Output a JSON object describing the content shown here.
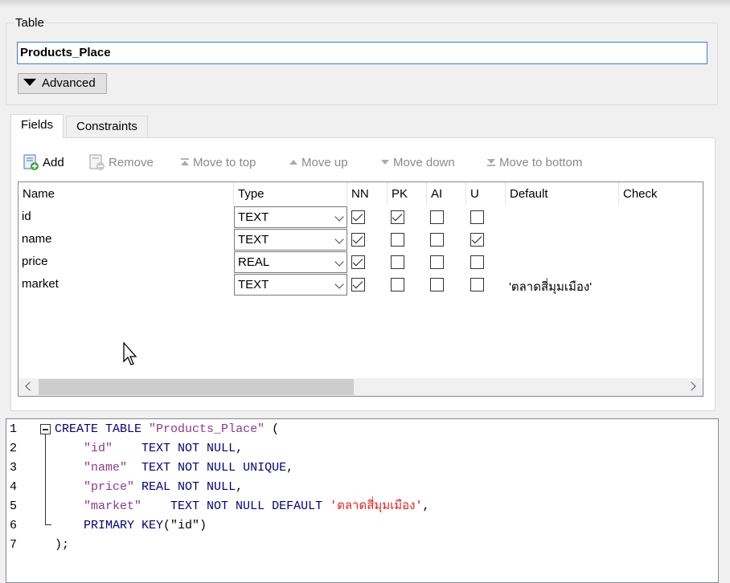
{
  "table_group": {
    "title": "Table",
    "name_value": "Products_Place",
    "advanced_label": "Advanced"
  },
  "tabs": [
    {
      "label": "Fields",
      "active": true
    },
    {
      "label": "Constraints",
      "active": false
    }
  ],
  "toolbar": {
    "add": "Add",
    "remove": "Remove",
    "move_top": "Move to top",
    "move_up": "Move up",
    "move_down": "Move down",
    "move_bottom": "Move to bottom"
  },
  "columns": {
    "name": "Name",
    "type": "Type",
    "nn": "NN",
    "pk": "PK",
    "ai": "AI",
    "u": "U",
    "default": "Default",
    "check": "Check"
  },
  "fields": [
    {
      "name": "id",
      "type": "TEXT",
      "nn": true,
      "pk": true,
      "ai": false,
      "u": false,
      "default": ""
    },
    {
      "name": "name",
      "type": "TEXT",
      "nn": true,
      "pk": false,
      "ai": false,
      "u": true,
      "default": ""
    },
    {
      "name": "price",
      "type": "REAL",
      "nn": true,
      "pk": false,
      "ai": false,
      "u": false,
      "default": ""
    },
    {
      "name": "market",
      "type": "TEXT",
      "nn": true,
      "pk": false,
      "ai": false,
      "u": false,
      "default": "'ตลาดสี่มุมเมือง'"
    }
  ],
  "sql": {
    "line_numbers": [
      "1",
      "2",
      "3",
      "4",
      "5",
      "6",
      "7"
    ],
    "l1_kw": "CREATE TABLE",
    "l1_str": "\"Products_Place\"",
    "l1_tail": " (",
    "l2_str": "\"id\"",
    "l2_kw": "TEXT NOT NULL",
    "l2_tail": ",",
    "l3_str": "\"name\"",
    "l3_kw": "TEXT NOT NULL UNIQUE",
    "l3_tail": ",",
    "l4_str": "\"price\"",
    "l4_kw": "REAL NOT NULL",
    "l4_tail": ",",
    "l5_str": "\"market\"",
    "l5_kw": "TEXT NOT NULL DEFAULT",
    "l5_sq": "'ตลาดสี่มุมเมือง'",
    "l5_tail": ",",
    "l6_kw": "PRIMARY KEY",
    "l6_tail": "(\"id\")",
    "l7": ");"
  },
  "colors": {
    "keyword": "#00007f",
    "identifier": "#8b3a8b",
    "string": "#e8221e",
    "focus_border": "#3c7fd6"
  },
  "icons": {
    "add": "add-field-icon",
    "remove": "remove-field-icon",
    "move_top": "move-to-top-icon",
    "move_up": "move-up-icon",
    "move_down": "move-down-icon",
    "move_bottom": "move-to-bottom-icon"
  }
}
